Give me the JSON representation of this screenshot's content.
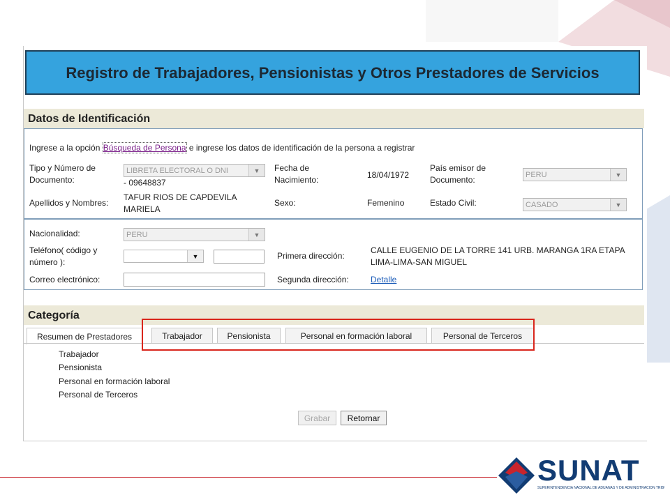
{
  "page": {
    "title": "Registro de Trabajadores, Pensionistas y Otros Prestadores de Servicios"
  },
  "identificacion": {
    "heading": "Datos de Identificación",
    "instruction_pre": "Ingrese a la opción ",
    "instruction_link": "Búsqueda de Persona",
    "instruction_post": " e ingrese los datos de identificación de la persona a registrar",
    "tipo_doc_label": "Tipo y Número de Documento:",
    "tipo_doc_value": "LIBRETA ELECTORAL O DNI",
    "doc_number": "-  09648837",
    "fecha_nac_label": "Fecha de Nacimiento:",
    "fecha_nac_value": "18/04/1972",
    "pais_emisor_label": "País emisor de Documento:",
    "pais_emisor_value": "PERU",
    "apellidos_label": "Apellidos y Nombres:",
    "apellidos_value": "TAFUR RIOS DE CAPDEVILA MARIELA",
    "sexo_label": "Sexo:",
    "sexo_value": "Femenino",
    "estado_civil_label": "Estado Civil:",
    "estado_civil_value": "CASADO"
  },
  "contacto": {
    "nacionalidad_label": "Nacionalidad:",
    "nacionalidad_value": "PERU",
    "telefono_label": "Teléfono( código y número ):",
    "telefono_code_value": "",
    "telefono_number_value": "",
    "correo_label": "Correo electrónico:",
    "correo_value": "",
    "primera_dir_label": "Primera dirección:",
    "primera_dir_value": "CALLE EUGENIO DE LA TORRE 141 URB. MARANGA 1RA ETAPA LIMA-LIMA-SAN MIGUEL",
    "segunda_dir_label": "Segunda dirección:",
    "segunda_dir_link": "Detalle"
  },
  "categoria": {
    "heading": "Categoría",
    "tabs": [
      {
        "label": "Resumen de Prestadores"
      },
      {
        "label": "Trabajador"
      },
      {
        "label": "Pensionista"
      },
      {
        "label": "Personal en formación laboral"
      },
      {
        "label": "Personal de Terceros"
      }
    ],
    "summary_items": [
      "Trabajador",
      "Pensionista",
      "Personal en formación laboral",
      "Personal de Terceros"
    ]
  },
  "buttons": {
    "grabar": "Grabar",
    "retornar": "Retornar"
  },
  "logo": {
    "word": "SUNAT",
    "subtitle": "SUPERINTENDENCIA NACIONAL DE ADUANAS Y DE ADMINISTRACIÓN TRIBUTARIA"
  },
  "colors": {
    "title_bg": "#35a3de",
    "highlight": "#d9261c",
    "logo_blue": "#123c73"
  }
}
